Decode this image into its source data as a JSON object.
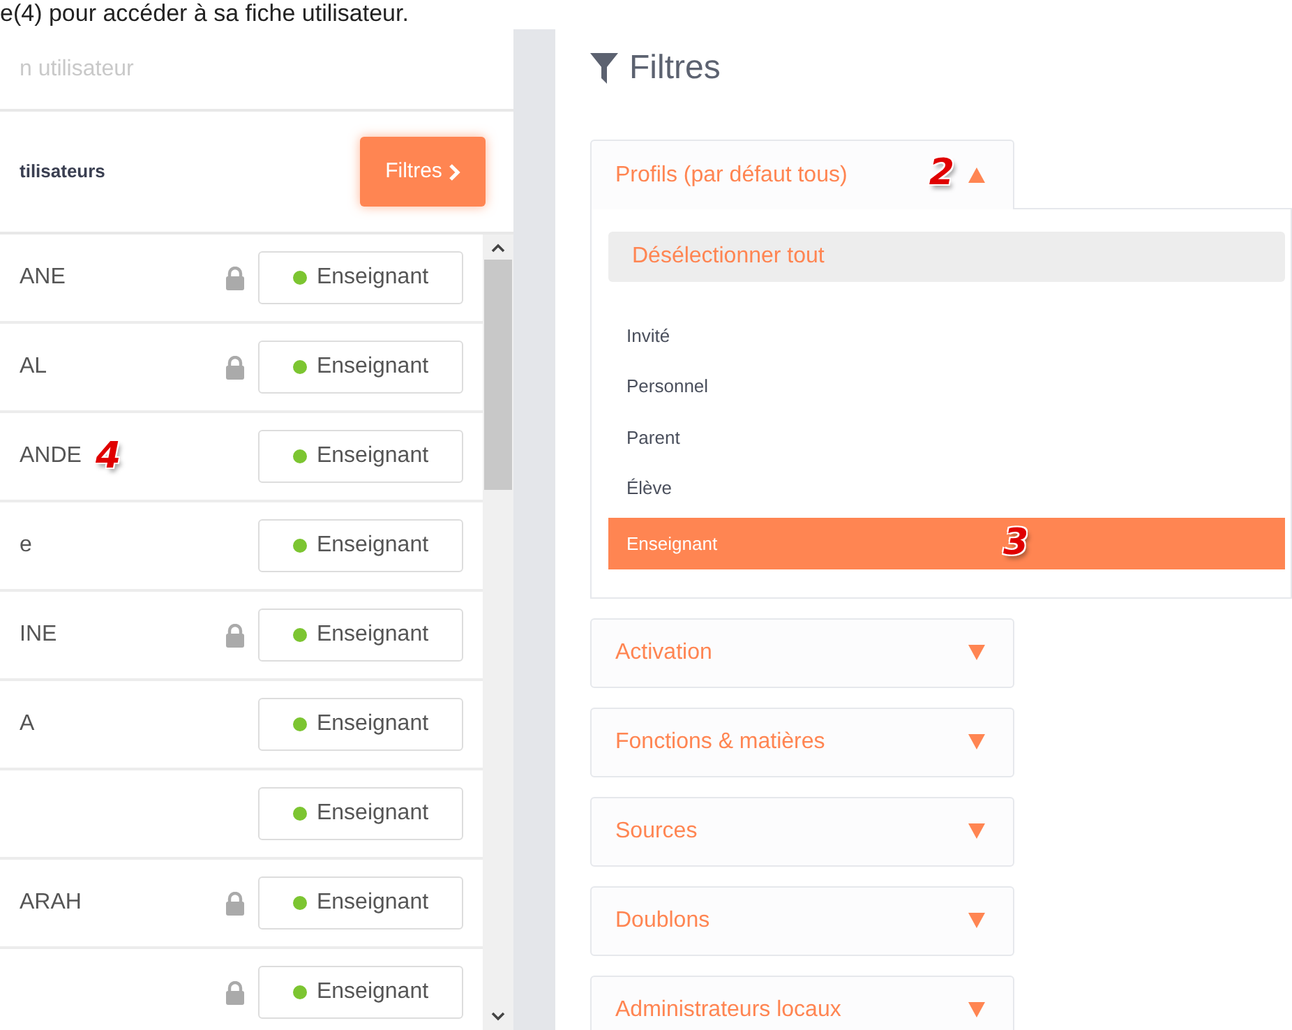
{
  "caption": "e(4) pour accéder à sa fiche utilisateur.",
  "search": {
    "placeholder": "n utilisateur"
  },
  "list_header": {
    "title": "tilisateurs",
    "button": "Filtres"
  },
  "users": [
    {
      "name": "ANE",
      "locked": true,
      "role": "Enseignant"
    },
    {
      "name": "AL",
      "locked": true,
      "role": "Enseignant"
    },
    {
      "name": "ANDE",
      "locked": false,
      "role": "Enseignant",
      "callout": "4"
    },
    {
      "name": "e",
      "locked": false,
      "role": "Enseignant"
    },
    {
      "name": "INE",
      "locked": true,
      "role": "Enseignant"
    },
    {
      "name": "A",
      "locked": false,
      "role": "Enseignant"
    },
    {
      "locked": false,
      "role": "Enseignant"
    },
    {
      "name": "ARAH",
      "locked": true,
      "role": "Enseignant"
    },
    {
      "locked": true,
      "role": "Enseignant"
    }
  ],
  "filters": {
    "title": "Filtres",
    "sections": [
      {
        "label": "Profils (par défaut tous)",
        "expanded": true,
        "callout": "2",
        "deselect": "Désélectionner tout",
        "options": [
          {
            "label": "Invité",
            "selected": false
          },
          {
            "label": "Personnel",
            "selected": false
          },
          {
            "label": "Parent",
            "selected": false
          },
          {
            "label": "Élève",
            "selected": false
          },
          {
            "label": "Enseignant",
            "selected": true,
            "callout": "3"
          }
        ]
      },
      {
        "label": "Activation",
        "expanded": false
      },
      {
        "label": "Fonctions & matières",
        "expanded": false
      },
      {
        "label": "Sources",
        "expanded": false
      },
      {
        "label": "Doublons",
        "expanded": false
      },
      {
        "label": "Administrateurs locaux",
        "expanded": false
      }
    ]
  }
}
